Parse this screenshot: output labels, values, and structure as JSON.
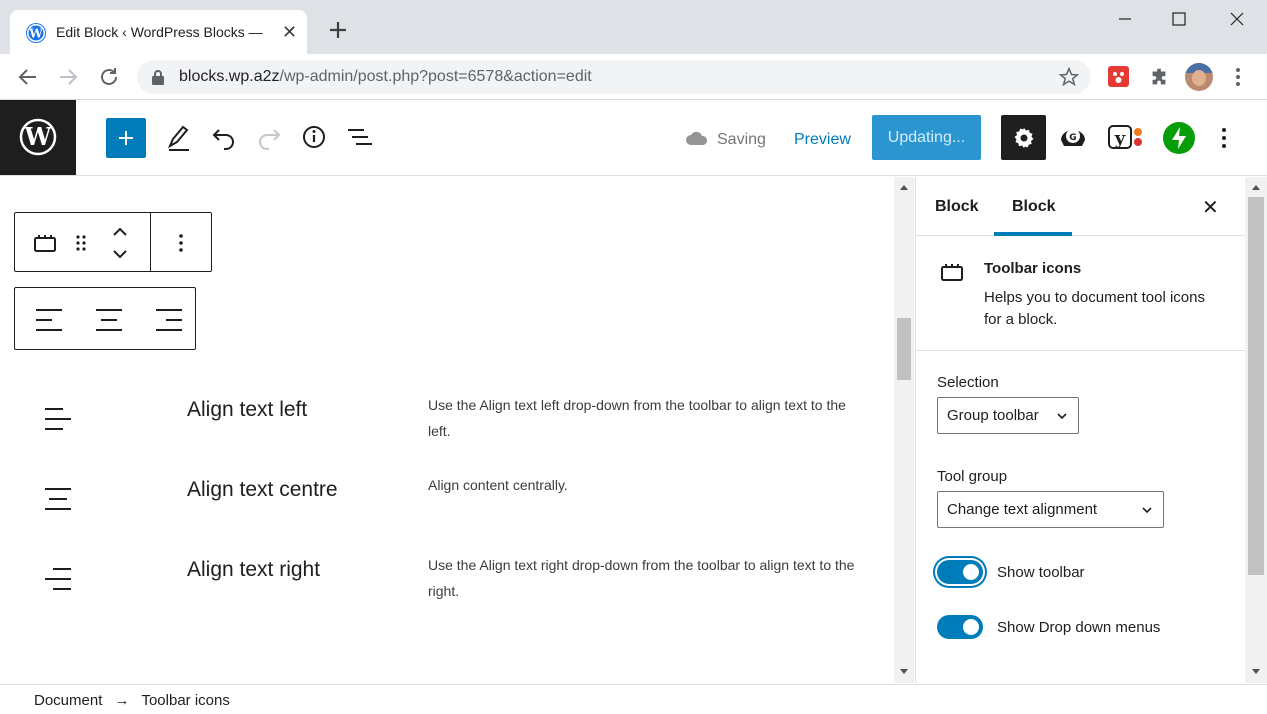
{
  "browser": {
    "tab_title": "Edit Block ‹ WordPress Blocks —",
    "url_host": "blocks.wp.a2z",
    "url_path": "/wp-admin/post.php?post=6578&action=edit"
  },
  "header": {
    "saving_label": "Saving",
    "preview_label": "Preview",
    "update_label": "Updating..."
  },
  "rows": [
    {
      "label": "Align text left",
      "description": "Use the Align text left drop-down from the toolbar to align text to the left.",
      "icon": "align-left-icon"
    },
    {
      "label": "Align text centre",
      "description": "Align content centrally.",
      "icon": "align-center-icon"
    },
    {
      "label": "Align text right",
      "description": "Use the Align text right drop-down from the toolbar to align text to the right.",
      "icon": "align-right-icon"
    }
  ],
  "sidebar": {
    "tabs": [
      "Block",
      "Block"
    ],
    "active_tab": 1,
    "block_name": "Toolbar icons",
    "block_description": "Helps you to document tool icons for a block.",
    "selection_label": "Selection",
    "selection_value": "Group toolbar",
    "tool_group_label": "Tool group",
    "tool_group_value": "Change text alignment",
    "show_toolbar_label": "Show toolbar",
    "show_toolbar": true,
    "show_dropdown_label": "Show Drop down menus",
    "show_dropdown": true
  },
  "breadcrumb": {
    "root": "Document",
    "separator": "→",
    "current": "Toolbar icons"
  },
  "colors": {
    "accent": "#007cba",
    "dark": "#1e1e1e",
    "jetpack": "#069e08"
  }
}
